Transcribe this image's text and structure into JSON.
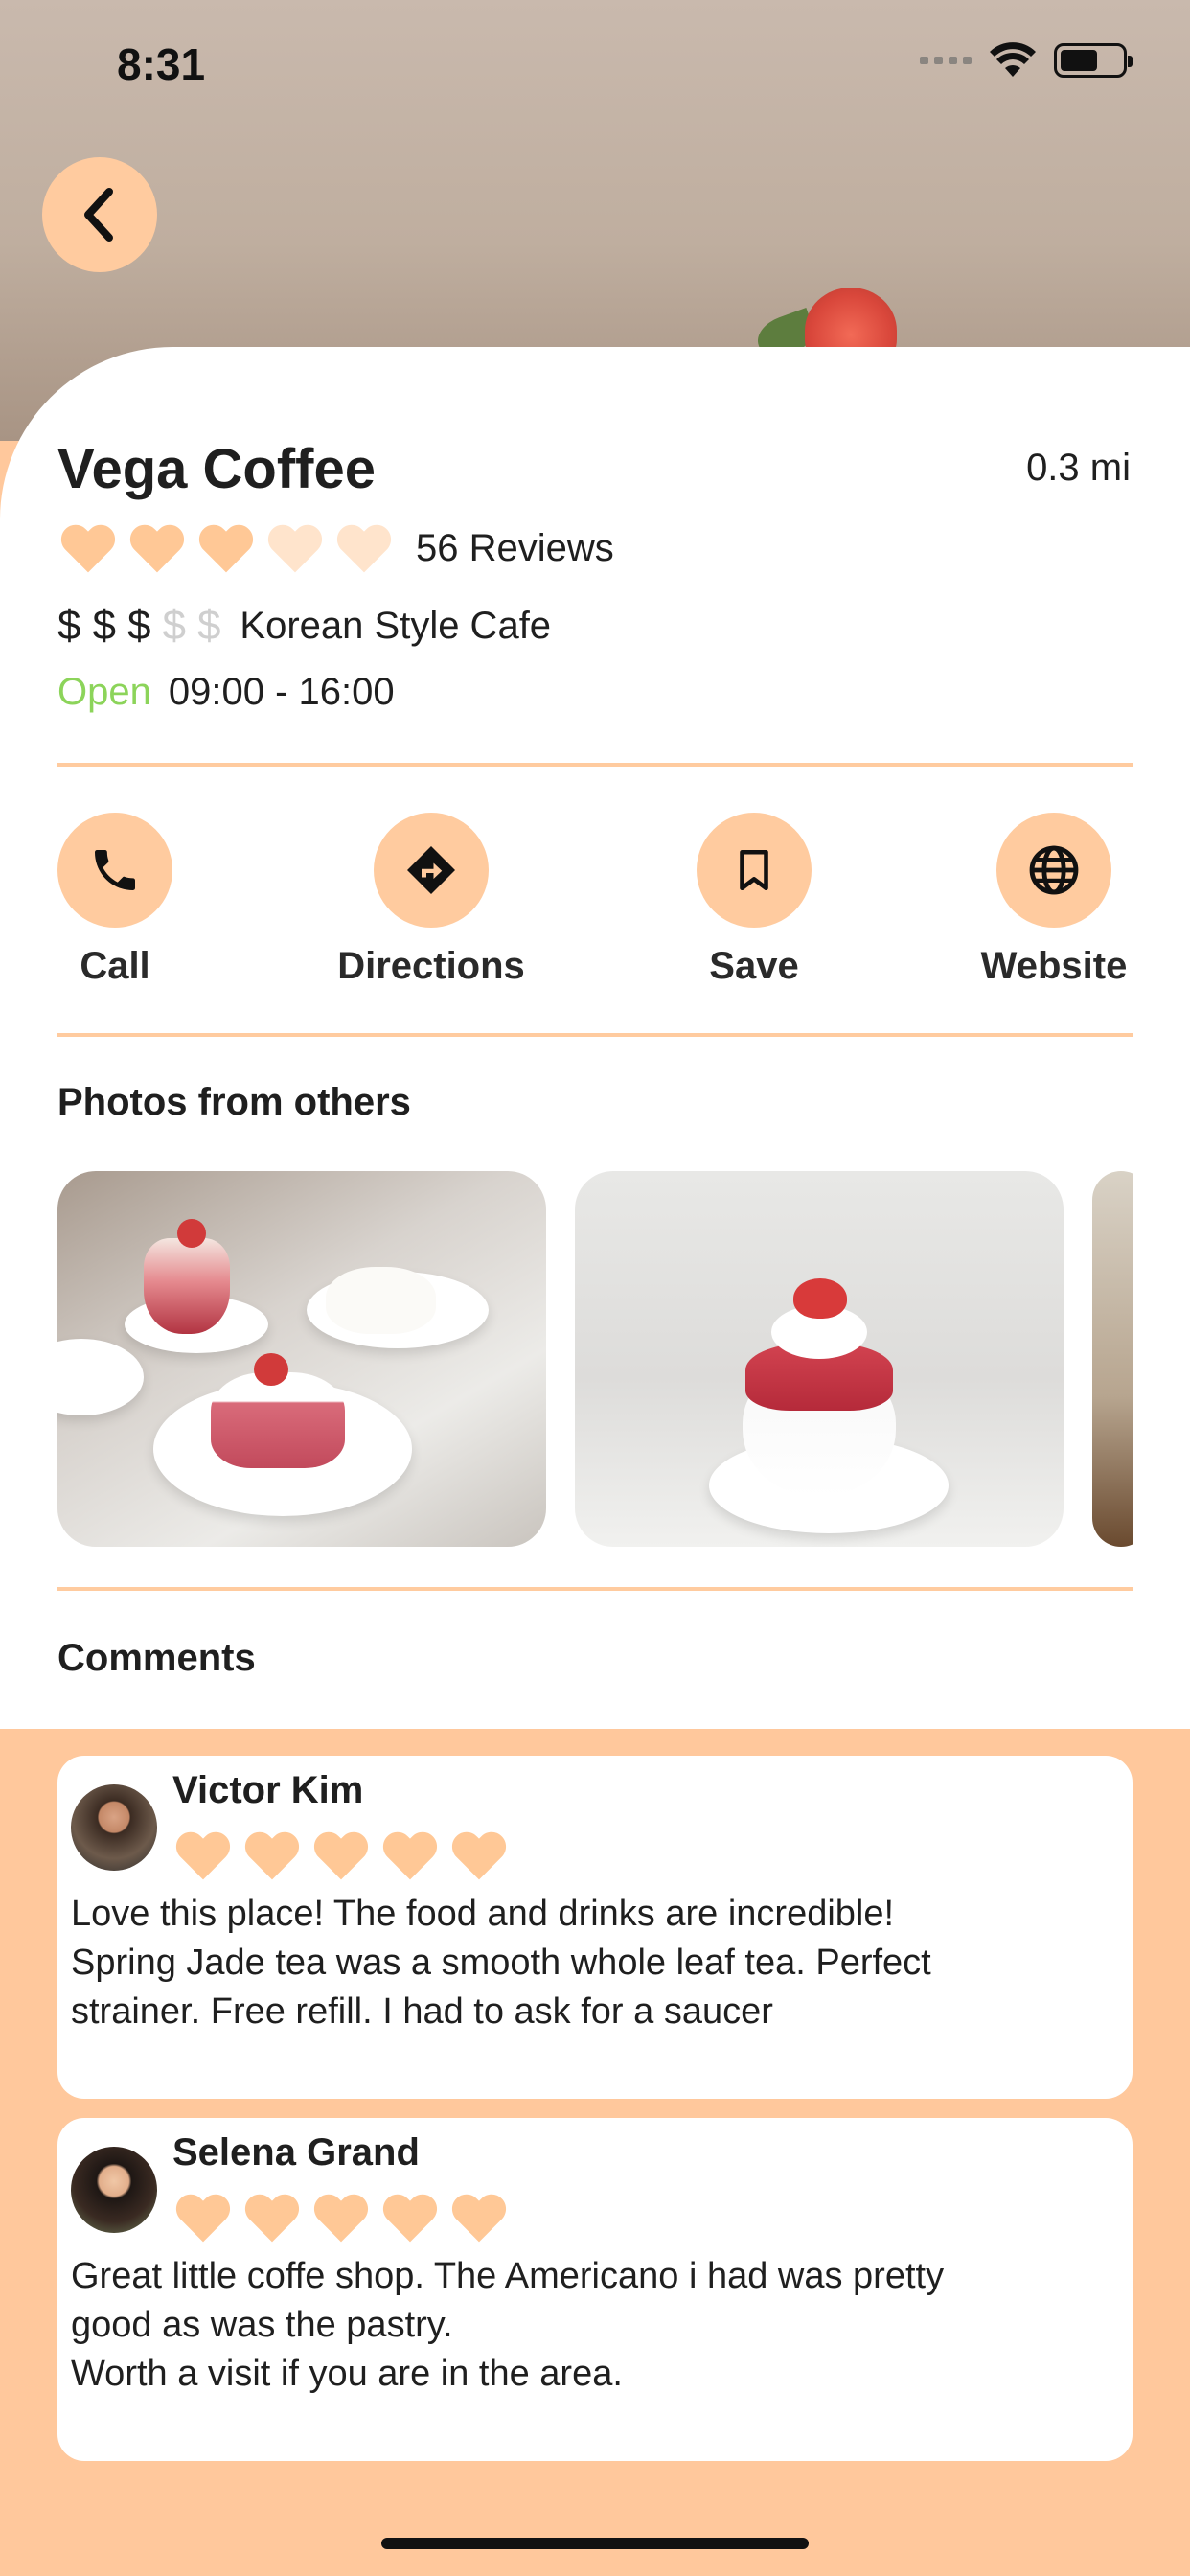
{
  "status_bar": {
    "time": "8:31"
  },
  "place": {
    "name": "Vega Coffee",
    "distance": "0.3 mi",
    "rating": 3,
    "rating_max": 5,
    "reviews_label": "56 Reviews",
    "price_level": 3,
    "price_max": 5,
    "price_symbol": "$",
    "category": "Korean Style Cafe",
    "open_label": "Open",
    "hours": "09:00 - 16:00"
  },
  "actions": [
    {
      "label": "Call",
      "icon": "phone-icon"
    },
    {
      "label": "Directions",
      "icon": "directions-icon"
    },
    {
      "label": "Save",
      "icon": "bookmark-icon"
    },
    {
      "label": "Website",
      "icon": "globe-icon"
    }
  ],
  "photos_section": {
    "title": "Photos from others"
  },
  "comments_section": {
    "title": "Comments"
  },
  "comments": [
    {
      "name": "Victor Kim",
      "rating": 5,
      "text": "Love this place! The food and drinks are incredible!\nSpring Jade tea was a smooth whole leaf tea. Perfect\nstrainer. Free refill. I had to ask for a saucer"
    },
    {
      "name": "Selena Grand",
      "rating": 5,
      "text": "Great little coffe shop. The Americano i had was pretty\ngood as was the pastry.\nWorth a visit if you are in the area."
    }
  ],
  "colors": {
    "accent": "#ffcb9f",
    "heart_full": "#ffc896",
    "heart_empty": "#ffe4cc",
    "open_green": "#8cd45a",
    "price_off": "#cfcfcf"
  }
}
